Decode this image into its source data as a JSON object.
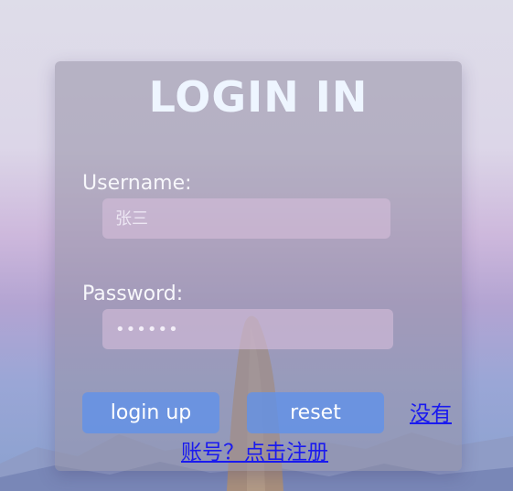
{
  "title": "LOGIN IN",
  "form": {
    "username_label": "Username:",
    "username_placeholder": "张三",
    "password_label": "Password:",
    "password_value": "123456"
  },
  "buttons": {
    "login_label": "login up",
    "reset_label": "reset"
  },
  "register_link": {
    "line1": "没有",
    "line2": "账号？点击注册"
  },
  "colors": {
    "title": "#eef5ff",
    "button_bg": "#5f91eb",
    "link": "#1a1aef",
    "panel_bg": "#9691a5"
  }
}
